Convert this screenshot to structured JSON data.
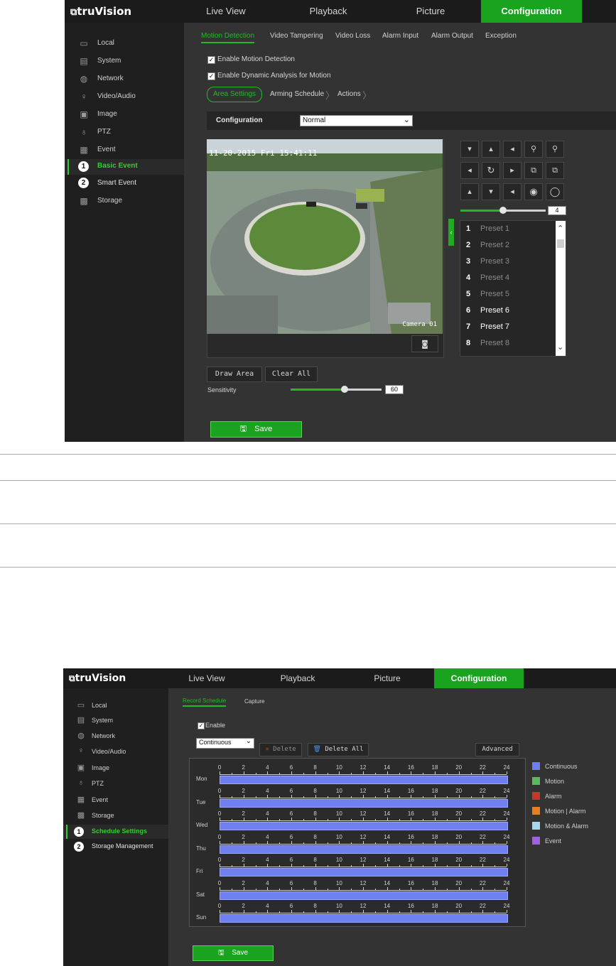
{
  "screen1": {
    "brand": "truVision",
    "nav": [
      "Live View",
      "Playback",
      "Picture",
      "Configuration"
    ],
    "sidebar": [
      "Local",
      "System",
      "Network",
      "Video/Audio",
      "Image",
      "PTZ",
      "Event",
      "Basic Event",
      "Smart Event",
      "Storage"
    ],
    "sidebar_icons": [
      "monitor-icon",
      "system-icon",
      "globe-icon",
      "video-audio-icon",
      "image-icon",
      "ptz-icon",
      "event-icon",
      "",
      "",
      "storage-icon"
    ],
    "callouts": [
      "1",
      "2"
    ],
    "subtabs": [
      "Motion Detection",
      "Video Tampering",
      "Video Loss",
      "Alarm Input",
      "Alarm Output",
      "Exception"
    ],
    "enable_motion": "Enable Motion Detection",
    "enable_dynamic": "Enable Dynamic Analysis for Motion",
    "steps": [
      "Area Settings",
      "Arming Schedule",
      "Actions"
    ],
    "config_label": "Configuration",
    "config_value": "Normal",
    "video_timestamp": "11-20-2015 Fri 15:41:11",
    "video_camera": "Camera 01",
    "ptz_speed": "4",
    "presets": [
      {
        "num": "1",
        "name": "Preset 1",
        "set": false
      },
      {
        "num": "2",
        "name": "Preset 2",
        "set": false
      },
      {
        "num": "3",
        "name": "Preset 3",
        "set": false
      },
      {
        "num": "4",
        "name": "Preset 4",
        "set": false
      },
      {
        "num": "5",
        "name": "Preset 5",
        "set": false
      },
      {
        "num": "6",
        "name": "Preset 6",
        "set": true
      },
      {
        "num": "7",
        "name": "Preset 7",
        "set": true
      },
      {
        "num": "8",
        "name": "Preset 8",
        "set": false
      }
    ],
    "draw_area": "Draw Area",
    "clear_all": "Clear All",
    "sensitivity_label": "Sensitivity",
    "sensitivity_value": "60",
    "save": "Save"
  },
  "screen2": {
    "brand": "truVision",
    "nav": [
      "Live View",
      "Playback",
      "Picture",
      "Configuration"
    ],
    "sidebar": [
      "Local",
      "System",
      "Network",
      "Video/Audio",
      "Image",
      "PTZ",
      "Event",
      "Storage",
      "Schedule Settings",
      "Storage Management"
    ],
    "sidebar_icons": [
      "monitor-icon",
      "system-icon",
      "globe-icon",
      "video-audio-icon",
      "image-icon",
      "ptz-icon",
      "event-icon",
      "storage-icon",
      "",
      ""
    ],
    "callouts": [
      "1",
      "2"
    ],
    "subtabs": [
      "Record Schedule",
      "Capture"
    ],
    "enable": "Enable",
    "record_type": "Continuous",
    "delete": "Delete",
    "delete_all": "Delete All",
    "advanced": "Advanced",
    "days": [
      "Mon",
      "Tue",
      "Wed",
      "Thu",
      "Fri",
      "Sat",
      "Sun"
    ],
    "hours": [
      "0",
      "2",
      "4",
      "6",
      "8",
      "10",
      "12",
      "14",
      "16",
      "18",
      "20",
      "22",
      "24"
    ],
    "legend": [
      {
        "label": "Continuous",
        "color": "#6f7ff0"
      },
      {
        "label": "Motion",
        "color": "#5cb85c"
      },
      {
        "label": "Alarm",
        "color": "#c0392b"
      },
      {
        "label": "Motion | Alarm",
        "color": "#e67e22"
      },
      {
        "label": "Motion & Alarm",
        "color": "#a8d8f0"
      },
      {
        "label": "Event",
        "color": "#a060e0"
      }
    ],
    "save": "Save"
  }
}
